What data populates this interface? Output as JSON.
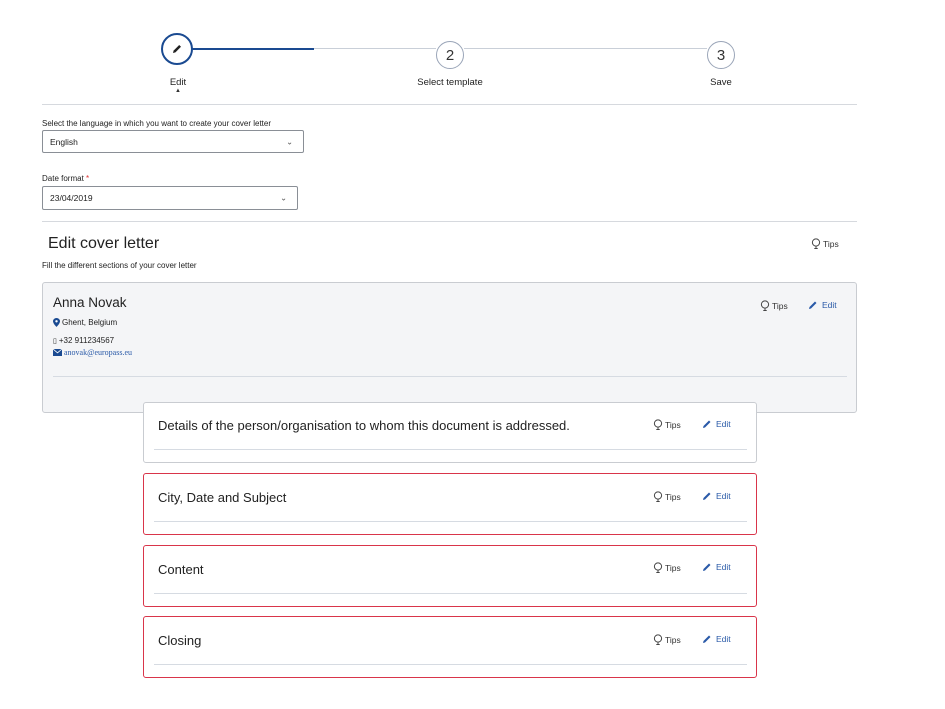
{
  "stepper": {
    "steps": [
      {
        "number": "",
        "label": "Edit",
        "active": true
      },
      {
        "number": "2",
        "label": "Select template",
        "active": false
      },
      {
        "number": "3",
        "label": "Save",
        "active": false
      }
    ]
  },
  "language": {
    "label": "Select the language in which you want to create your cover letter",
    "value": "English"
  },
  "date_format": {
    "label": "Date format",
    "required_mark": "*",
    "value": "23/04/2019"
  },
  "section": {
    "title": "Edit cover letter",
    "subtitle": "Fill the different sections of your cover letter",
    "tips_label": "Tips"
  },
  "profile": {
    "name": "Anna Novak",
    "location": "Ghent, Belgium",
    "phone": "+32 911234567",
    "email": "anovak@europass.eu",
    "tips_label": "Tips",
    "edit_label": "Edit"
  },
  "cards": [
    {
      "title": "Details of the person/organisation to whom this document is addressed.",
      "tips_label": "Tips",
      "edit_label": "Edit",
      "state": "normal"
    },
    {
      "title": "City, Date and Subject",
      "tips_label": "Tips",
      "edit_label": "Edit",
      "state": "error"
    },
    {
      "title": "Content",
      "tips_label": "Tips",
      "edit_label": "Edit",
      "state": "error"
    },
    {
      "title": "Closing",
      "tips_label": "Tips",
      "edit_label": "Edit",
      "state": "error"
    }
  ],
  "colors": {
    "primary": "#1a4a91",
    "link": "#2a5aa8",
    "error": "#d9354a",
    "panel": "#f4f5f7"
  }
}
